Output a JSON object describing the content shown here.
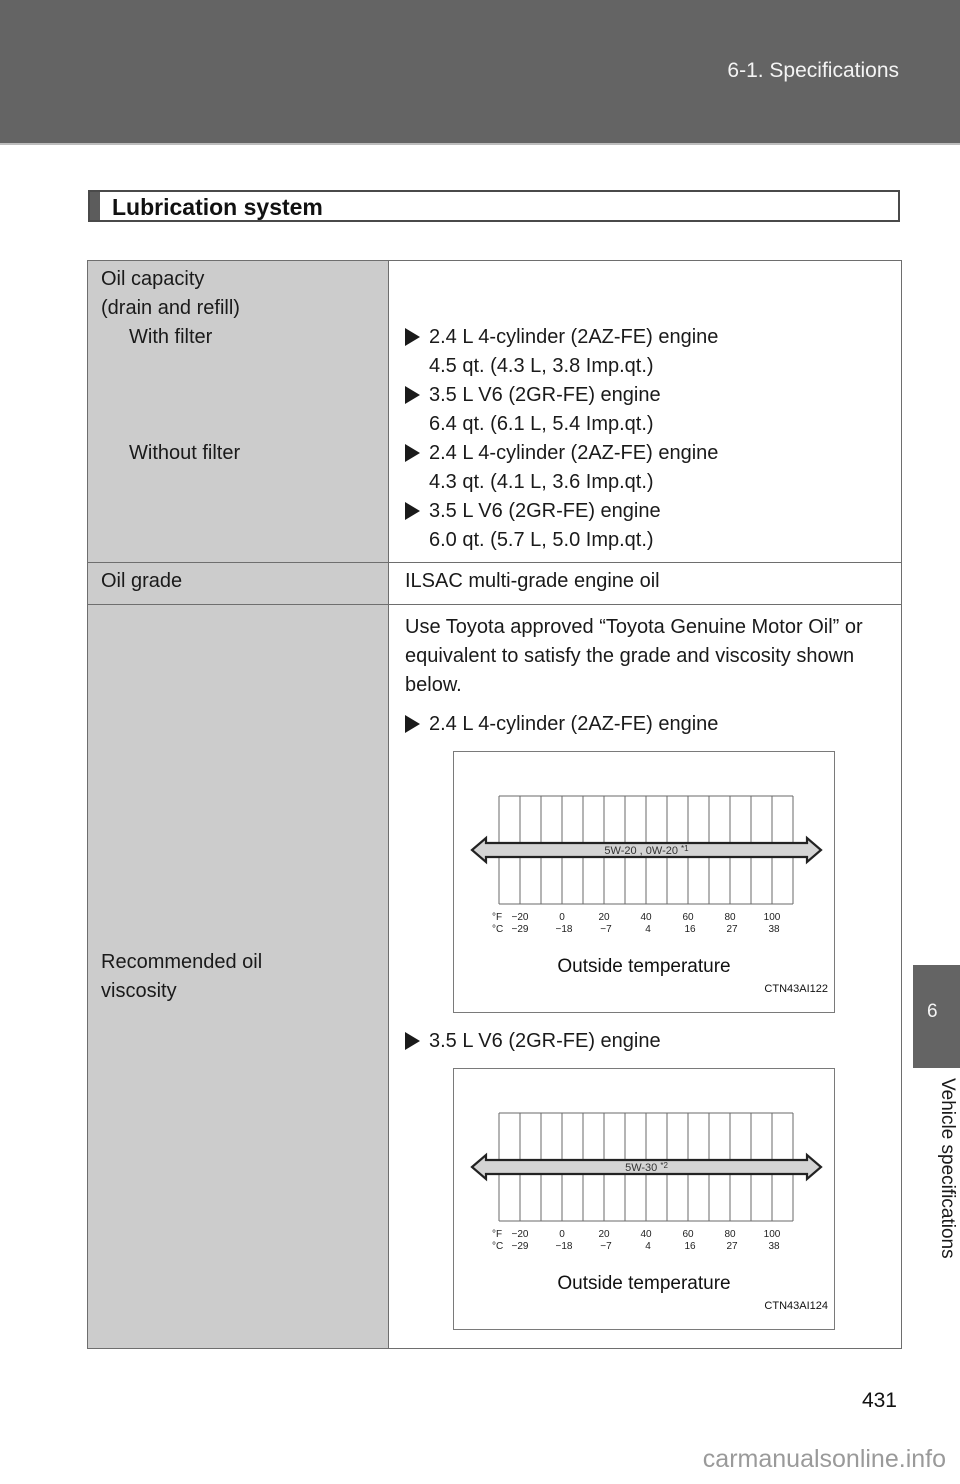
{
  "header": {
    "section_title": "6-1. Specifications"
  },
  "side_tab": {
    "chapter_number": "6",
    "chapter_label": "Vehicle specifications"
  },
  "section": {
    "title": "Lubrication system"
  },
  "table": {
    "oil_capacity": {
      "label_line1": "Oil capacity",
      "label_line2": "(drain and refill)",
      "with_filter_label": "With filter",
      "without_filter_label": "Without filter",
      "with_filter": [
        {
          "engine": "2.4 L 4-cylinder (2AZ-FE) engine",
          "capacity": "4.5 qt. (4.3 L, 3.8 Imp.qt.)"
        },
        {
          "engine": "3.5 L V6 (2GR-FE) engine",
          "capacity": "6.4 qt. (6.1 L, 5.4 Imp.qt.)"
        }
      ],
      "without_filter": [
        {
          "engine": "2.4 L 4-cylinder (2AZ-FE) engine",
          "capacity": "4.3 qt. (4.1 L, 3.6 Imp.qt.)"
        },
        {
          "engine": "3.5 L V6 (2GR-FE) engine",
          "capacity": "6.0 qt. (5.7 L, 5.0 Imp.qt.)"
        }
      ]
    },
    "oil_grade": {
      "label": "Oil grade",
      "value": "ILSAC multi-grade engine oil"
    },
    "viscosity": {
      "label_line1": "Recommended oil",
      "label_line2": "viscosity",
      "intro": "Use Toyota approved “Toyota Genuine Motor Oil” or equivalent to satisfy the grade and viscosity shown below."
    }
  },
  "chart_data": [
    {
      "type": "range",
      "engine": "2.4 L 4-cylinder (2AZ-FE) engine",
      "grade_label": "5W-20 , 0W-20",
      "footnote": "*1",
      "x_range_F": [
        -30,
        110
      ],
      "arrow_both_ends": true,
      "f_unit": "°F",
      "c_unit": "°C",
      "f_ticks": [
        "−20",
        "0",
        "20",
        "40",
        "60",
        "80",
        "100"
      ],
      "c_ticks": [
        "−29",
        "−18",
        "−7",
        "4",
        "16",
        "27",
        "38"
      ],
      "xlabel": "Outside temperature",
      "figure_code": "CTN43AI122"
    },
    {
      "type": "range",
      "engine": "3.5 L V6 (2GR-FE) engine",
      "grade_label": "5W-30",
      "footnote": "*2",
      "x_range_F": [
        -30,
        110
      ],
      "arrow_both_ends": true,
      "f_unit": "°F",
      "c_unit": "°C",
      "f_ticks": [
        "−20",
        "0",
        "20",
        "40",
        "60",
        "80",
        "100"
      ],
      "c_ticks": [
        "−29",
        "−18",
        "−7",
        "4",
        "16",
        "27",
        "38"
      ],
      "xlabel": "Outside temperature",
      "figure_code": "CTN43AI124"
    }
  ],
  "footer": {
    "page_number": "431",
    "watermark": "carmanualsonline.info"
  }
}
